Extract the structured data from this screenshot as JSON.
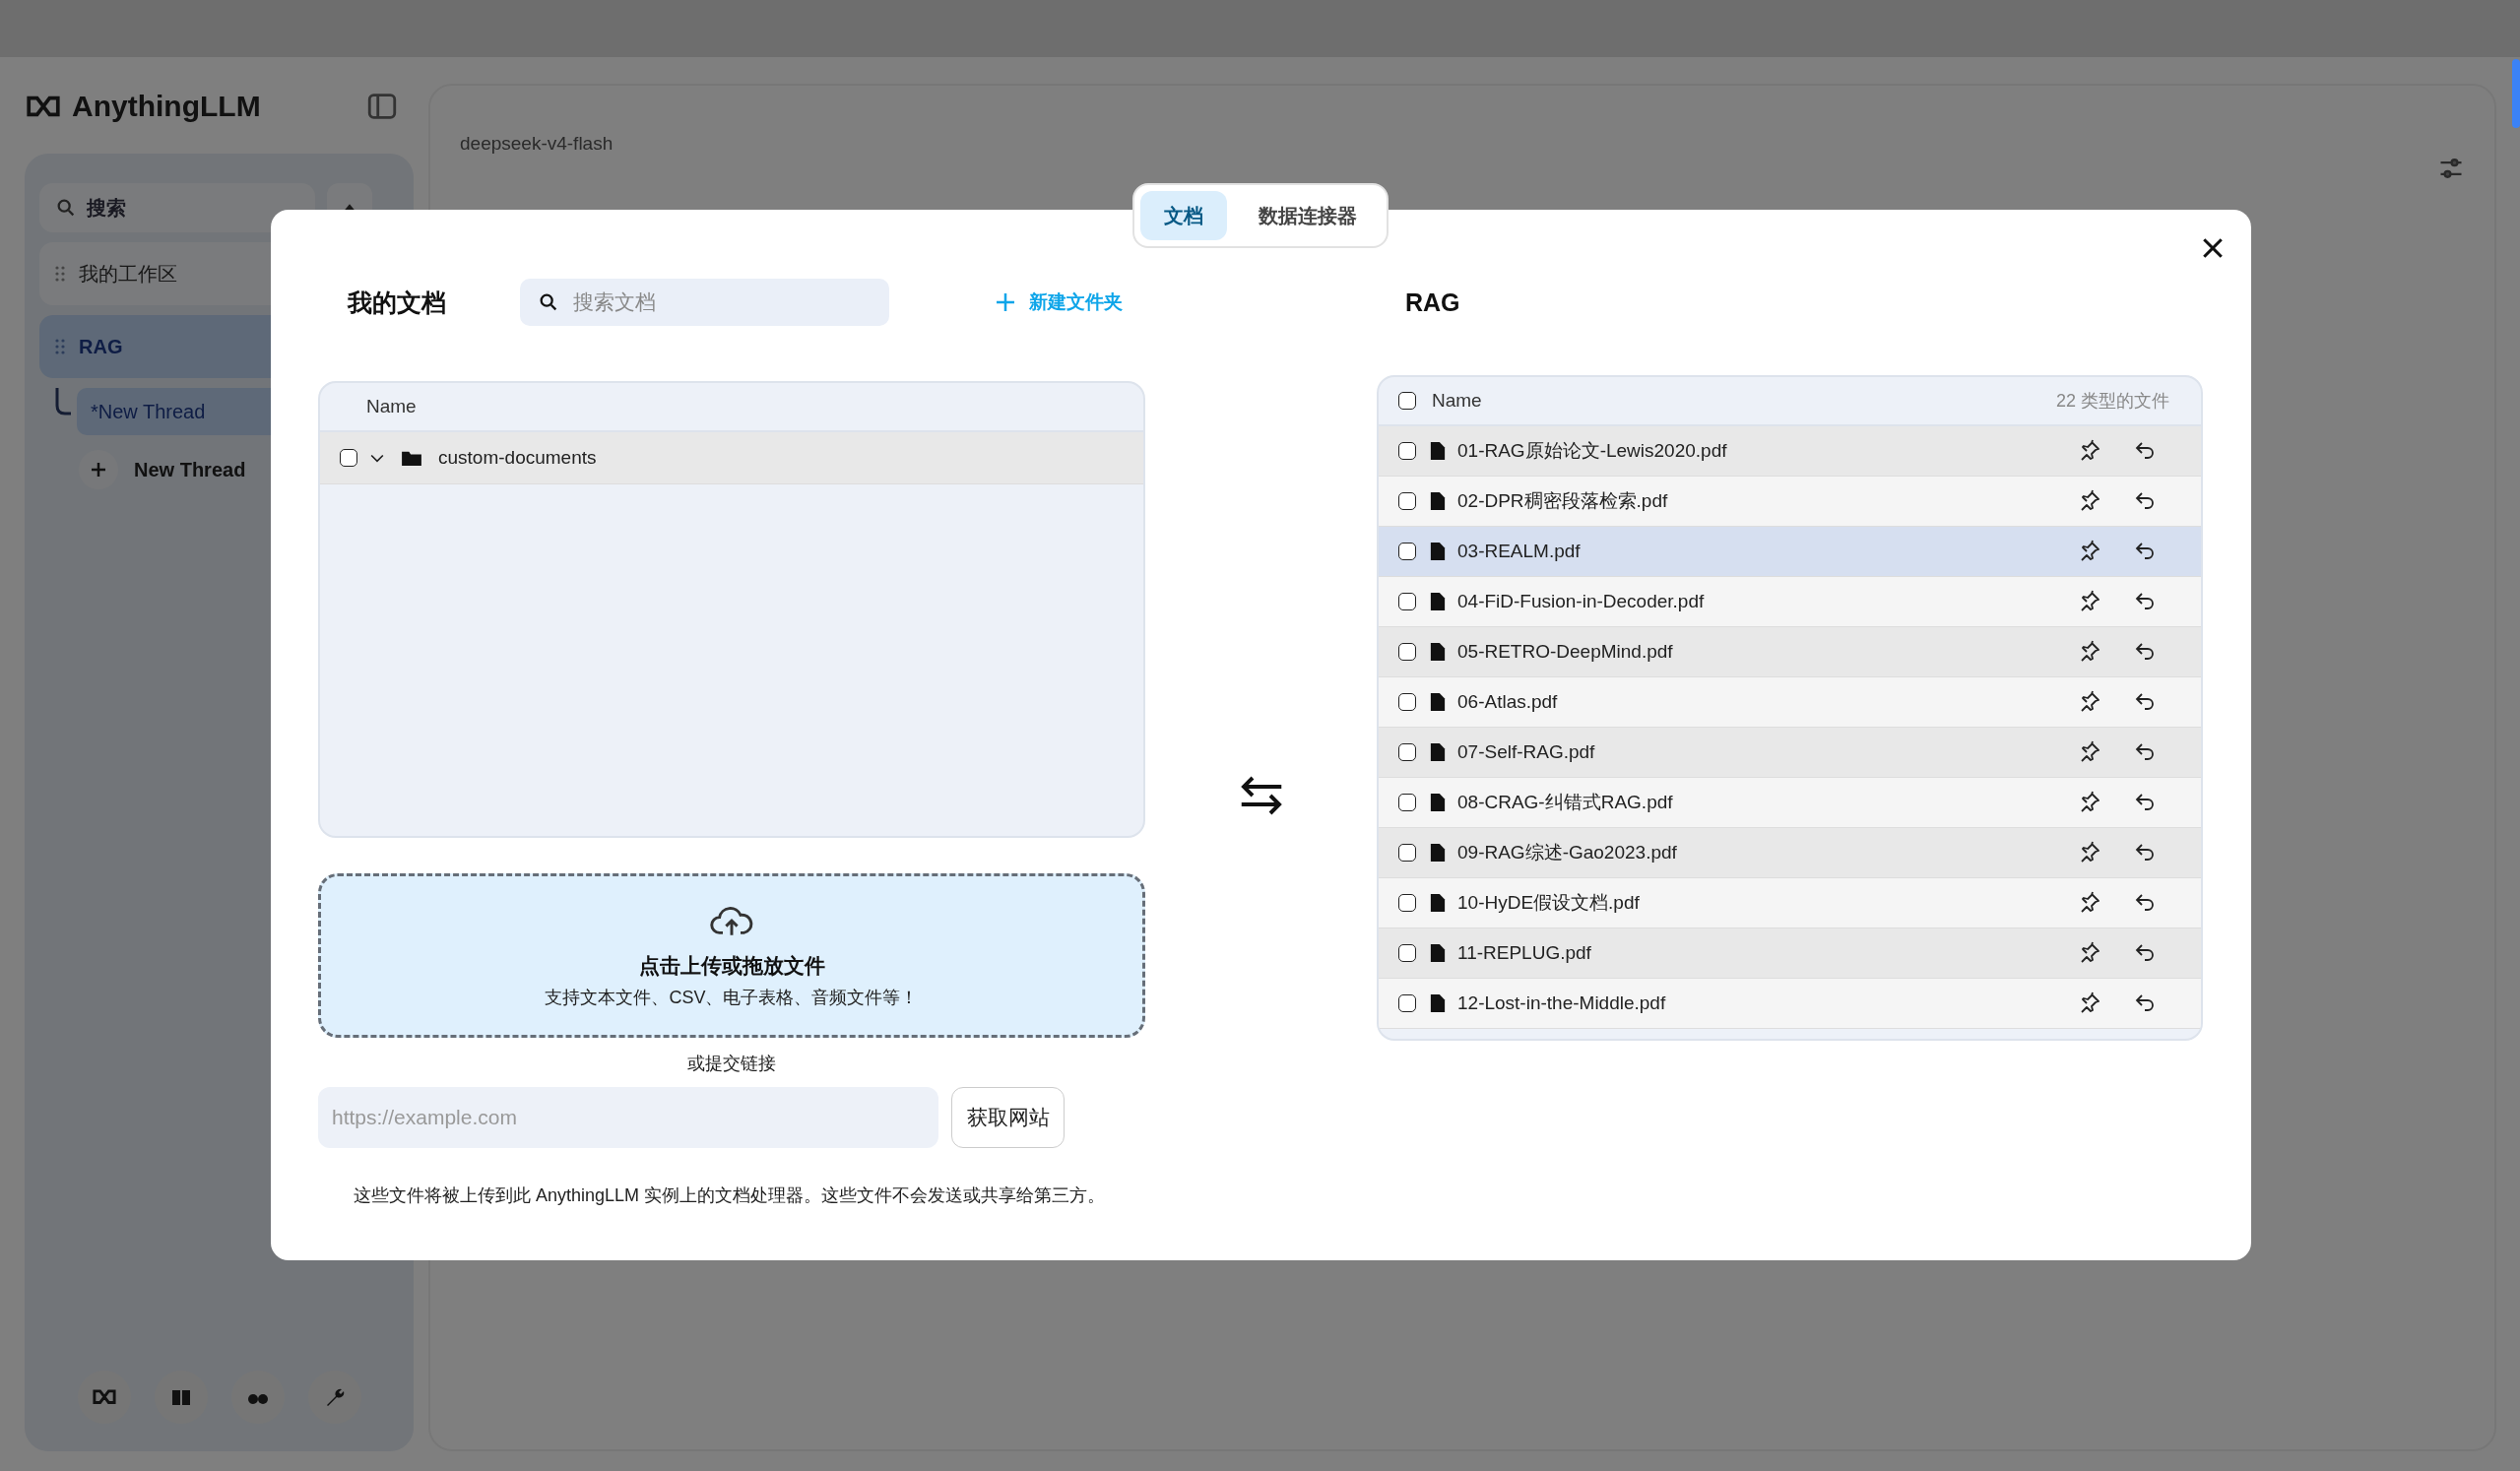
{
  "app": {
    "logo": "AnythingLLM",
    "search_placeholder": "搜索",
    "workspaces": [
      {
        "name": "我的工作区",
        "selected": false
      },
      {
        "name": "RAG",
        "selected": true,
        "children": [
          {
            "name": "*New Thread",
            "selected": true
          }
        ]
      }
    ],
    "new_thread": "New Thread",
    "model": "deepseek-v4-flash"
  },
  "modal": {
    "tabs": [
      {
        "label": "文档",
        "selected": true
      },
      {
        "label": "数据连接器",
        "selected": false
      }
    ],
    "my_documents": {
      "title": "我的文档",
      "search_placeholder": "搜索文档",
      "new_folder": "新建文件夹",
      "column": "Name",
      "folders": [
        {
          "name": "custom-documents",
          "checked": false,
          "expanded": true
        }
      ]
    },
    "upload": {
      "title": "点击上传或拖放文件",
      "hint": "支持文本文件、CSV、电子表格、音频文件等！"
    },
    "link_label": "或提交链接",
    "url_placeholder": "https://example.com",
    "fetch_button": "获取网站",
    "footer": "这些文件将被上传到此 AnythingLLM 实例上的文档处理器。这些文件不会发送或共享给第三方。",
    "workspace_docs": {
      "title": "RAG",
      "column": "Name",
      "count": "22 类型的文件",
      "all_checked": false,
      "files": [
        {
          "name": "01-RAG原始论文-Lewis2020.pdf",
          "checked": false,
          "hovered": false
        },
        {
          "name": "02-DPR稠密段落检索.pdf",
          "checked": false,
          "hovered": false
        },
        {
          "name": "03-REALM.pdf",
          "checked": false,
          "hovered": true
        },
        {
          "name": "04-FiD-Fusion-in-Decoder.pdf",
          "checked": false,
          "hovered": false
        },
        {
          "name": "05-RETRO-DeepMind.pdf",
          "checked": false,
          "hovered": false
        },
        {
          "name": "06-Atlas.pdf",
          "checked": false,
          "hovered": false
        },
        {
          "name": "07-Self-RAG.pdf",
          "checked": false,
          "hovered": false
        },
        {
          "name": "08-CRAG-纠错式RAG.pdf",
          "checked": false,
          "hovered": false
        },
        {
          "name": "09-RAG综述-Gao2023.pdf",
          "checked": false,
          "hovered": false
        },
        {
          "name": "10-HyDE假设文档.pdf",
          "checked": false,
          "hovered": false
        },
        {
          "name": "11-REPLUG.pdf",
          "checked": false,
          "hovered": false
        },
        {
          "name": "12-Lost-in-the-Middle.pdf",
          "checked": false,
          "hovered": false
        }
      ]
    }
  }
}
